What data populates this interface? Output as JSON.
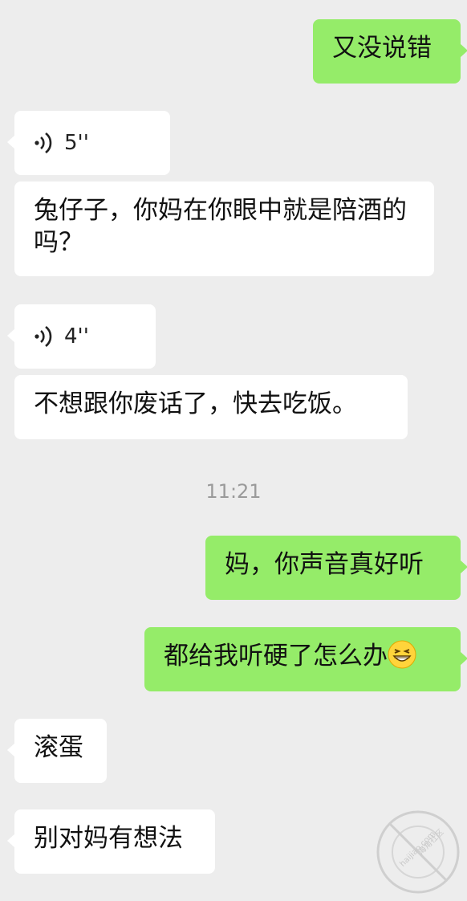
{
  "messages": [
    {
      "side": "right",
      "type": "text",
      "text": "又没说错"
    },
    {
      "side": "left",
      "type": "voice",
      "duration": "5''"
    },
    {
      "side": "left",
      "type": "text",
      "text": "兔仔子，你妈在你眼中就是陪酒的吗？"
    },
    {
      "side": "left",
      "type": "voice",
      "duration": "4''"
    },
    {
      "side": "left",
      "type": "text",
      "text": "不想跟你废话了，快去吃饭。"
    },
    {
      "side": "right",
      "type": "text",
      "text": "妈，你声音真好听"
    },
    {
      "side": "right",
      "type": "text",
      "text": "都给我听硬了怎么办",
      "emoji": "grinning-squint-emoji"
    },
    {
      "side": "left",
      "type": "text",
      "text": "滚蛋"
    },
    {
      "side": "left",
      "type": "text",
      "text": "别对妈有想法"
    }
  ],
  "timestamp": "11:21",
  "watermark": {
    "site": "haijiao.com",
    "cn": "海角社区"
  },
  "colors": {
    "background": "#ededed",
    "sent_bubble": "#95ec69",
    "received_bubble": "#ffffff"
  }
}
